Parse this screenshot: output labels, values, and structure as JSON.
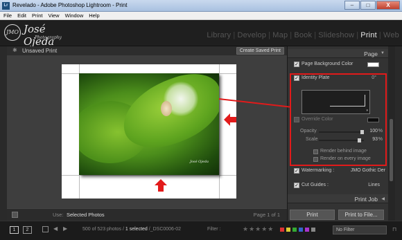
{
  "window": {
    "app_icon": "Lr",
    "title": "Revelado - Adobe Photoshop Lightroom - Print",
    "controls": [
      "–",
      "□",
      "X"
    ]
  },
  "menu": [
    "File",
    "Edit",
    "Print",
    "View",
    "Window",
    "Help"
  ],
  "identity_plate": {
    "seal": "JMO",
    "name": "José Ojeda",
    "sub": "Photography"
  },
  "modules": [
    "Library",
    "Develop",
    "Map",
    "Book",
    "Slideshow",
    "Print",
    "Web"
  ],
  "active_module": "Print",
  "work": {
    "star": "✱",
    "title": "Unsaved Print",
    "create_button": "Create Saved Print",
    "photo_signature": "José Ojeda"
  },
  "bottom_toolbar": {
    "use_label": "Use:",
    "use_value": "Selected Photos",
    "page_info": "Page 1 of 1"
  },
  "panel": {
    "page_header": "Page",
    "page_background_label": "Page Background Color",
    "identity_plate_label": "Identity Plate",
    "identity_plate_angle": "0°",
    "override_color_label": "Override Color",
    "opacity_label": "Opacity",
    "opacity_value": "100",
    "scale_label": "Scale",
    "scale_value": "93",
    "percent": "%",
    "render_behind_label": "Render behind image",
    "render_every_label": "Render on every image",
    "watermarking_label": "Watermarking :",
    "watermarking_value": "JMO Gothic Der",
    "cut_guides_label": "Cut Guides :",
    "cut_guides_value": "Lines",
    "print_job_header": "Print Job",
    "print_button": "Print",
    "print_to_file_button": "Print to File..."
  },
  "filmstrip": {
    "screen1": "1",
    "screen2": "2",
    "count_prefix": "500 of 523 photos /",
    "selected": "1 selected",
    "filename": "/_DSC0006-02",
    "filter_label": "Filter :",
    "stars": "★★★★★",
    "filter_value": "No Filter",
    "color_flags": [
      "#d33",
      "#dc3",
      "#3a3",
      "#36c",
      "#a3c",
      "#888"
    ]
  },
  "colors": {
    "annotation_red": "#e21a1a",
    "panel_bg": "#333333",
    "work_bg": "#3e3e3e"
  },
  "icons": [
    "app-icon",
    "minimize-icon",
    "maximize-icon",
    "close-icon",
    "checkbox-icon",
    "collapse-triangle-icon",
    "grid-icon",
    "prev-arrow-icon",
    "next-arrow-icon",
    "lock-icon"
  ]
}
